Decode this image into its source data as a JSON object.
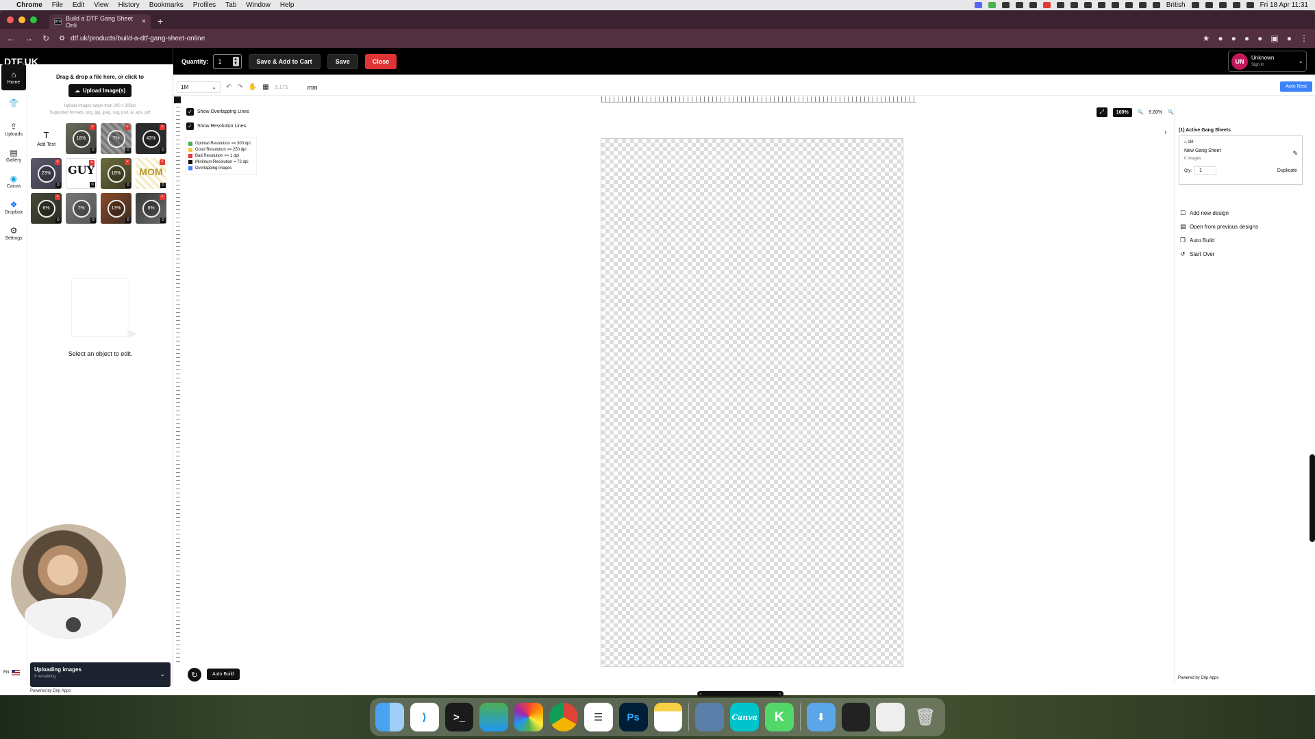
{
  "menubar": {
    "app": "Chrome",
    "items": [
      "File",
      "Edit",
      "View",
      "History",
      "Bookmarks",
      "Profiles",
      "Tab",
      "Window",
      "Help"
    ],
    "input_lang": "British",
    "datetime": "Fri 18 Apr 11:31"
  },
  "browser": {
    "tab_title": "Build a DTF Gang Sheet Onli",
    "url": "dtf.uk/products/build-a-dtf-gang-sheet-online"
  },
  "header": {
    "logo": "DTF.UK",
    "quantity_label": "Quantity:",
    "quantity_value": "1",
    "save_add_cart": "Save & Add to Cart",
    "save": "Save",
    "close": "Close",
    "user_initials": "UN",
    "user_name": "Unknown",
    "user_sub": "Sign In"
  },
  "rail": [
    {
      "label": "Home",
      "icon": "home-icon",
      "active": true
    },
    {
      "label": "",
      "icon": "tshirt-icon"
    },
    {
      "label": "Uploads",
      "icon": "upload-icon"
    },
    {
      "label": "Gallery",
      "icon": "gallery-icon"
    },
    {
      "label": "Canva",
      "icon": "canva-icon"
    },
    {
      "label": "Dropbox",
      "icon": "dropbox-icon"
    },
    {
      "label": "Settings",
      "icon": "gear-icon"
    }
  ],
  "lang": "EN",
  "upload": {
    "title": "Drag & drop a file here, or click to",
    "button": "Upload Image(s)",
    "note": "Upload images larger than 300 x 300px",
    "formats": "Supported formats: png, jpg, jpeg, svg, psd, ai, eps, pdf"
  },
  "add_text": "Add Text",
  "thumbs": [
    {
      "pct": "18%",
      "count": "0"
    },
    {
      "pct": "7%",
      "count": "0"
    },
    {
      "pct": "43%",
      "count": "0"
    },
    {
      "pct": "23%",
      "count": "0"
    },
    {
      "pct": "",
      "count": "0",
      "text": "GUY"
    },
    {
      "pct": "18%",
      "count": "0"
    },
    {
      "pct": "",
      "count": "0",
      "text": "MOM"
    },
    {
      "pct": "6%",
      "count": "0"
    },
    {
      "pct": "7%",
      "count": "0"
    },
    {
      "pct": "13%",
      "count": "0"
    },
    {
      "pct": "6%",
      "count": "0"
    }
  ],
  "select_object": "Select an object to edit.",
  "uploading": {
    "title": "Uploading images",
    "sub": "9 remaining"
  },
  "powered_by": "Powered by Drip Apps",
  "toolbar": {
    "size": "1M",
    "value": "3.175",
    "unit": "mm",
    "auto_nest": "Auto Nest"
  },
  "canvas": {
    "show_overlapping": "Show Overlapping Lines",
    "show_resolution": "Show Resolution Lines",
    "legend": [
      {
        "label": "Optimal Resolution >= 300 dpi",
        "color": "#4caf50"
      },
      {
        "label": "Good Resolution >= 250 dpi",
        "color": "#f2c94c"
      },
      {
        "label": "Bad Resolution >= 1 dpi",
        "color": "#e53935"
      },
      {
        "label": "Minimum Resolution = 72 dpi",
        "color": "#111111"
      },
      {
        "label": "Overlapping images",
        "color": "#3b82f6"
      }
    ],
    "auto_build": "Auto Build",
    "zoom": "100%",
    "zoom_level": "9.80%"
  },
  "right": {
    "title": "(1) Active Gang Sheets",
    "sheet_size": "1M",
    "sheet_name": "New Gang Sheet",
    "sheet_images": "0 Images",
    "qty_label": "Qty:",
    "qty_value": "1",
    "duplicate": "Duplicate",
    "actions": [
      {
        "label": "Add new design",
        "icon": "add-design-icon"
      },
      {
        "label": "Open from previous designs",
        "icon": "folder-icon"
      },
      {
        "label": "Auto Build",
        "icon": "build-icon"
      },
      {
        "label": "Start Over",
        "icon": "reset-icon"
      }
    ]
  }
}
